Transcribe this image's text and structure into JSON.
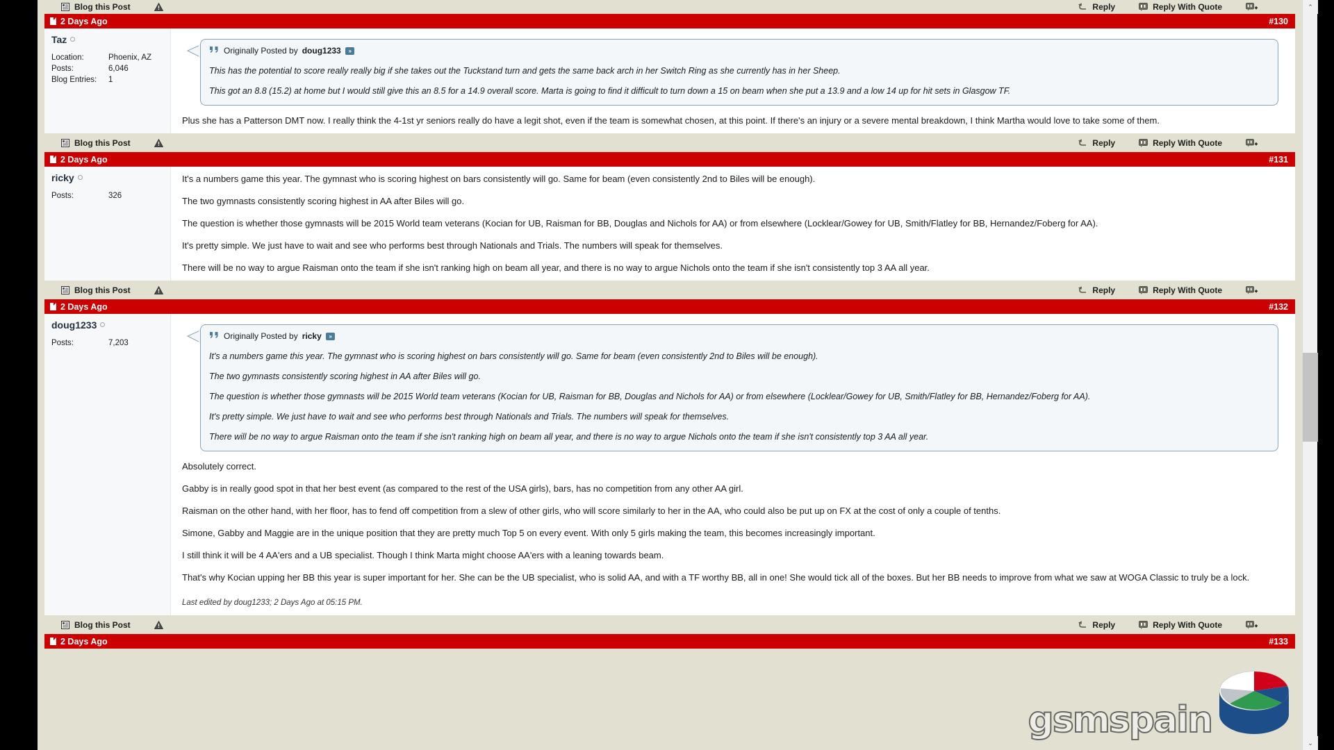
{
  "theme": {
    "header_red": "#cc0000",
    "page_bg": "#e2e1d1",
    "post_bg": "#ffffff",
    "userinfo_bg": "#f7f8fa",
    "quote_border": "#8ba2b5",
    "quote_bg": "#f3f7f9"
  },
  "controls": {
    "blog_this_post": "Blog this Post",
    "reply": "Reply",
    "reply_with_quote": "Reply With Quote",
    "blog_icon": "blog-icon",
    "warn_icon": "warning-triangle-icon",
    "reply_icon": "reply-arrow-icon",
    "quote_icon": "speech-bubble-icon",
    "multiquote_icon": "multiquote-plus-icon"
  },
  "quote_labels": {
    "originally_posted_by": "Originally Posted by",
    "goto_post": "»"
  },
  "posts": [
    {
      "timestamp": "2 Days Ago",
      "number": "#130",
      "author": "Taz",
      "online": true,
      "stats": [
        {
          "key": "Location:",
          "value": "Phoenix, AZ"
        },
        {
          "key": "Posts:",
          "value": "6,046"
        },
        {
          "key": "Blog Entries:",
          "value": "1"
        }
      ],
      "quote": {
        "author": "doug1233",
        "paragraphs": [
          "This has the potential to score really really big if she takes out the Tuckstand turn and gets the same back arch in her Switch Ring as she currently has in her Sheep.",
          "This got an 8.8 (15.2) at home but I would still give this an 8.5 for a 14.9 overall score. Marta is going to find it difficult to turn down a 15 on beam when she put a 13.9 and a low 14 up for hit sets in Glasgow TF."
        ]
      },
      "paragraphs": [
        "Plus she has a Patterson DMT now. I really think the 4-1st yr seniors really do have a legit shot, even if the team is somewhat chosen, at this point. If there's an injury or a severe mental breakdown, I think Martha would love to take some of them."
      ],
      "last_edited": null
    },
    {
      "timestamp": "2 Days Ago",
      "number": "#131",
      "author": "ricky",
      "online": true,
      "stats": [
        {
          "key": "Posts:",
          "value": "326"
        }
      ],
      "quote": null,
      "paragraphs": [
        "It's a numbers game this year. The gymnast who is scoring highest on bars consistently will go. Same for beam (even consistently 2nd to Biles will be enough).",
        "The two gymnasts consistently scoring highest in AA after Biles will go.",
        "The question is whether those gymnasts will be 2015 World team veterans (Kocian for UB, Raisman for BB, Douglas and Nichols for AA) or from elsewhere (Locklear/Gowey for UB, Smith/Flatley for BB, Hernandez/Foberg for AA).",
        "It's pretty simple. We just have to wait and see who performs best through Nationals and Trials. The numbers will speak for themselves.",
        "There will be no way to argue Raisman onto the team if she isn't ranking high on beam all year, and there is no way to argue Nichols onto the team if she isn't consistently top 3 AA all year."
      ],
      "last_edited": null
    },
    {
      "timestamp": "2 Days Ago",
      "number": "#132",
      "author": "doug1233",
      "online": true,
      "stats": [
        {
          "key": "Posts:",
          "value": "7,203"
        }
      ],
      "quote": {
        "author": "ricky",
        "paragraphs": [
          "It's a numbers game this year. The gymnast who is scoring highest on bars consistently will go. Same for beam (even consistently 2nd to Biles will be enough).",
          "The two gymnasts consistently scoring highest in AA after Biles will go.",
          "The question is whether those gymnasts will be 2015 World team veterans (Kocian for UB, Raisman for BB, Douglas and Nichols for AA) or from elsewhere (Locklear/Gowey for UB, Smith/Flatley for BB, Hernandez/Foberg for AA).",
          "It's pretty simple. We just have to wait and see who performs best through Nationals and Trials. The numbers will speak for themselves.",
          "There will be no way to argue Raisman onto the team if she isn't ranking high on beam all year, and there is no way to argue Nichols onto the team if she isn't consistently top 3 AA all year."
        ]
      },
      "paragraphs": [
        "Absolutely correct.",
        "Gabby is in really good spot in that her best event (as compared to the rest of the USA girls), bars, has no competition from any other AA girl.",
        "Raisman on the other hand, with her floor, has to fend off competition from a slew of other girls, who will score similarly to her in the AA, who could also be put up on FX at the cost of only a couple of tenths.",
        "Simone, Gabby and Maggie are in the unique position that they are pretty much Top 5 on every event. With only 5 girls making the team, this becomes increasingly important.",
        "I still think it will be 4 AA'ers and a UB specialist. Though I think Marta might choose AA'ers with a leaning towards beam.",
        "That's why Kocian upping her BB this year is super important for her. She can be the UB specialist, who is solid AA, and with a TF worthy BB, all in one! She would tick all of the boxes. But her BB needs to improve from what we saw at WOGA Classic to truly be a lock."
      ],
      "last_edited": "Last edited by doug1233; 2 Days Ago at 05:15 PM."
    }
  ],
  "next_post_preview": {
    "timestamp": "2 Days Ago",
    "number": "#133"
  },
  "watermark": {
    "text": "gsmspain",
    "logo": "pie-chart-logo"
  },
  "scrollbar": {
    "up_arrow": "⌃",
    "down_arrow": "⌄"
  }
}
